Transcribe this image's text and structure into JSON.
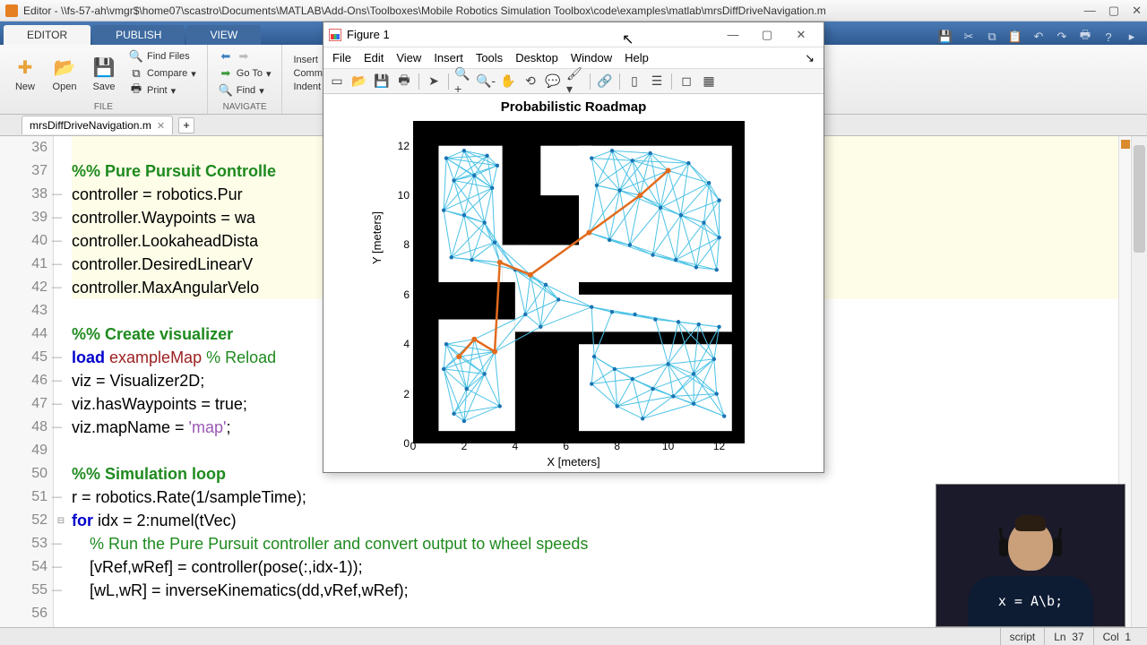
{
  "window": {
    "title": "Editor - \\\\fs-57-ah\\vmgr$\\home07\\scastro\\Documents\\MATLAB\\Add-Ons\\Toolboxes\\Mobile Robotics Simulation Toolbox\\code\\examples\\matlab\\mrsDiffDriveNavigation.m"
  },
  "tabs": {
    "editor": "EDITOR",
    "publish": "PUBLISH",
    "view": "VIEW"
  },
  "toolstrip": {
    "new": "New",
    "open": "Open",
    "save": "Save",
    "findfiles": "Find Files",
    "compare": "Compare",
    "print": "Print",
    "goto": "Go To",
    "find": "Find",
    "insert": "Insert",
    "comment": "Comment",
    "indent": "Indent",
    "group_file": "FILE",
    "group_nav": "NAVIGATE"
  },
  "filetab": {
    "name": "mrsDiffDriveNavigation.m"
  },
  "lines": {
    "start": 36,
    "rows": [
      {
        "n": 36,
        "cls": "hlsection",
        "html": ""
      },
      {
        "n": 37,
        "cls": "hlsection",
        "html": "<span class='c-comment'>%% Pure Pursuit Controlle</span>"
      },
      {
        "n": 38,
        "cls": "hlsection",
        "html": "<span class='c-text'>controller = robotics.Pur</span>",
        "dash": true
      },
      {
        "n": 39,
        "cls": "hlsection",
        "html": "<span class='c-text'>controller.Waypoints = wa</span>",
        "dash": true
      },
      {
        "n": 40,
        "cls": "hlsection",
        "html": "<span class='c-text'>controller.LookaheadDista</span>",
        "dash": true
      },
      {
        "n": 41,
        "cls": "hlsection",
        "html": "<span class='c-text'>controller.DesiredLinearV</span>",
        "dash": true
      },
      {
        "n": 42,
        "cls": "hlsection",
        "html": "<span class='c-text'>controller.MaxAngularVelo</span>",
        "dash": true
      },
      {
        "n": 43,
        "cls": "",
        "html": ""
      },
      {
        "n": 44,
        "cls": "",
        "html": "<span class='c-comment'>%% Create visualizer</span>"
      },
      {
        "n": 45,
        "cls": "",
        "html": "<span class='c-keyword'>load</span> <span class='c-unterm'>exampleMap</span> <span class='c-comment-n'>% Reload</span>",
        "dash": true
      },
      {
        "n": 46,
        "cls": "",
        "html": "<span class='c-text'>viz = Visualizer2D;</span>",
        "dash": true
      },
      {
        "n": 47,
        "cls": "",
        "html": "<span class='c-text'>viz.hasWaypoints = true;</span>",
        "dash": true
      },
      {
        "n": 48,
        "cls": "",
        "html": "<span class='c-text'>viz.mapName = </span><span class='c-string'>'map'</span><span class='c-text'>;</span>",
        "dash": true
      },
      {
        "n": 49,
        "cls": "",
        "html": ""
      },
      {
        "n": 50,
        "cls": "",
        "html": "<span class='c-comment'>%% Simulation loop</span>"
      },
      {
        "n": 51,
        "cls": "",
        "html": "<span class='c-text'>r = robotics.Rate(1/sampleTime);</span>",
        "dash": true
      },
      {
        "n": 52,
        "cls": "",
        "html": "<span class='c-keyword'>for</span><span class='c-text'> idx = 2:numel(tVec)</span>",
        "fold": true
      },
      {
        "n": 53,
        "cls": "",
        "html": "    <span class='c-comment-n'>% Run the Pure Pursuit controller and convert output to wheel speeds</span>",
        "dash": true
      },
      {
        "n": 54,
        "cls": "",
        "html": "    <span class='c-text'>[vRef,wRef] = controller(pose(:,idx-1));</span>",
        "dash": true
      },
      {
        "n": 55,
        "cls": "",
        "html": "    <span class='c-text'>[wL,wR] = inverseKinematics(dd,vRef,wRef);</span>",
        "dash": true
      },
      {
        "n": 56,
        "cls": "",
        "html": ""
      }
    ]
  },
  "status": {
    "type": "script",
    "ln_label": "Ln",
    "ln": 37,
    "col_label": "Col",
    "col": 1
  },
  "figure": {
    "title": "Figure 1",
    "menus": [
      "File",
      "Edit",
      "View",
      "Insert",
      "Tools",
      "Desktop",
      "Window",
      "Help"
    ]
  },
  "chart_data": {
    "type": "scatter",
    "title": "Probabilistic Roadmap",
    "xlabel": "X [meters]",
    "ylabel": "Y [meters]",
    "xlim": [
      0,
      13
    ],
    "ylim": [
      0,
      13
    ],
    "xticks": [
      0,
      2,
      4,
      6,
      8,
      10,
      12
    ],
    "yticks": [
      0,
      2,
      4,
      6,
      8,
      10,
      12
    ],
    "obstacles_free_rects": [
      {
        "x": 1,
        "y": 6.5,
        "w": 2.5,
        "h": 5.5
      },
      {
        "x": 1,
        "y": 0.5,
        "w": 3,
        "h": 4.5
      },
      {
        "x": 3.5,
        "y": 6.5,
        "w": 1,
        "h": 1.5
      },
      {
        "x": 5,
        "y": 10,
        "w": 2,
        "h": 2
      },
      {
        "x": 6.5,
        "y": 6.5,
        "w": 6,
        "h": 5.5
      },
      {
        "x": 6.5,
        "y": 4.5,
        "w": 6,
        "h": 1.5
      },
      {
        "x": 6.5,
        "y": 0.5,
        "w": 6,
        "h": 3.5
      },
      {
        "x": 4,
        "y": 4.5,
        "w": 2.5,
        "h": 3.5
      }
    ],
    "nodes": [
      [
        1.3,
        11.5
      ],
      [
        2.0,
        11.8
      ],
      [
        2.9,
        11.6
      ],
      [
        3.3,
        11.2
      ],
      [
        1.6,
        10.6
      ],
      [
        2.4,
        10.8
      ],
      [
        3.1,
        10.3
      ],
      [
        1.2,
        9.4
      ],
      [
        2.0,
        9.2
      ],
      [
        2.8,
        8.9
      ],
      [
        3.2,
        8.1
      ],
      [
        1.5,
        7.5
      ],
      [
        2.3,
        7.4
      ],
      [
        3.4,
        7.3
      ],
      [
        4.0,
        7.0
      ],
      [
        4.6,
        6.8
      ],
      [
        5.2,
        6.4
      ],
      [
        5.7,
        5.8
      ],
      [
        4.4,
        5.2
      ],
      [
        5.0,
        4.7
      ],
      [
        1.3,
        4.0
      ],
      [
        1.2,
        3.0
      ],
      [
        1.8,
        3.5
      ],
      [
        2.1,
        2.2
      ],
      [
        2.8,
        2.8
      ],
      [
        2.4,
        4.2
      ],
      [
        3.2,
        3.7
      ],
      [
        1.6,
        1.2
      ],
      [
        3.4,
        1.5
      ],
      [
        2.0,
        0.9
      ],
      [
        7.0,
        11.5
      ],
      [
        7.8,
        11.8
      ],
      [
        8.6,
        11.4
      ],
      [
        9.3,
        11.7
      ],
      [
        10.0,
        11.0
      ],
      [
        10.8,
        11.3
      ],
      [
        11.6,
        10.5
      ],
      [
        12.0,
        9.8
      ],
      [
        7.2,
        10.4
      ],
      [
        8.1,
        10.2
      ],
      [
        8.9,
        10.0
      ],
      [
        9.7,
        9.5
      ],
      [
        10.5,
        9.2
      ],
      [
        11.4,
        8.9
      ],
      [
        12.0,
        8.3
      ],
      [
        6.9,
        8.5
      ],
      [
        7.7,
        8.2
      ],
      [
        8.5,
        8.0
      ],
      [
        9.4,
        7.6
      ],
      [
        10.3,
        7.4
      ],
      [
        11.1,
        7.1
      ],
      [
        11.9,
        7.0
      ],
      [
        7.0,
        5.5
      ],
      [
        7.8,
        5.3
      ],
      [
        8.7,
        5.2
      ],
      [
        9.5,
        5.0
      ],
      [
        10.4,
        4.9
      ],
      [
        11.2,
        4.8
      ],
      [
        12.0,
        4.7
      ],
      [
        7.1,
        3.5
      ],
      [
        7.0,
        2.4
      ],
      [
        7.9,
        3.0
      ],
      [
        8.6,
        2.6
      ],
      [
        8.0,
        1.5
      ],
      [
        9.4,
        2.2
      ],
      [
        9.0,
        1.0
      ],
      [
        10.2,
        1.9
      ],
      [
        10.0,
        3.2
      ],
      [
        11.0,
        1.6
      ],
      [
        11.0,
        2.8
      ],
      [
        11.9,
        2.0
      ],
      [
        11.8,
        3.4
      ],
      [
        12.2,
        1.1
      ]
    ],
    "path": [
      [
        1.8,
        3.5
      ],
      [
        2.4,
        4.2
      ],
      [
        3.2,
        3.7
      ],
      [
        3.4,
        7.3
      ],
      [
        4.6,
        6.8
      ],
      [
        6.9,
        8.5
      ],
      [
        8.9,
        10.0
      ],
      [
        10.0,
        11.0
      ]
    ],
    "series": [
      {
        "name": "PRM edges",
        "type": "line",
        "color": "#4cc3e6"
      },
      {
        "name": "PRM nodes",
        "type": "scatter",
        "color": "#1a74b3"
      },
      {
        "name": "Planned path",
        "type": "line",
        "color": "#e26b1e"
      }
    ]
  },
  "webcam": {
    "equation": "x = A\\b;"
  }
}
